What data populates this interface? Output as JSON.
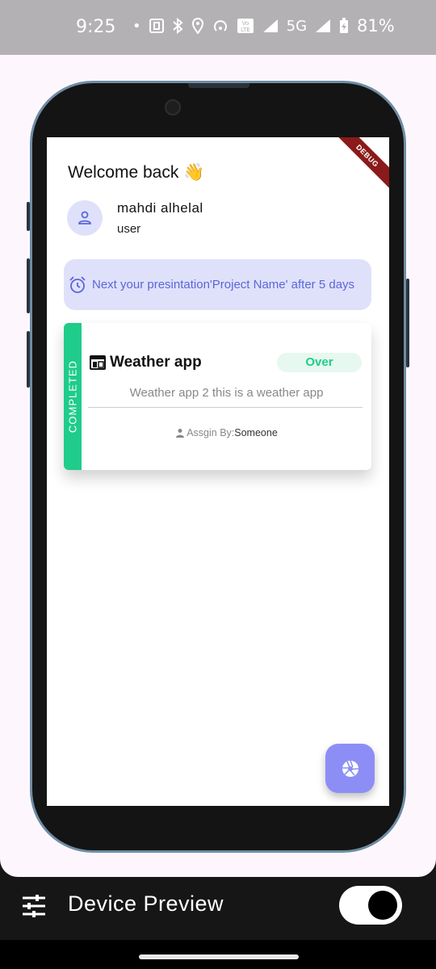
{
  "status_bar": {
    "time": "9:25",
    "network": "5G",
    "battery": "81%"
  },
  "app": {
    "debug_banner": "DEBUG",
    "greeting": "Welcome back 👋",
    "user": {
      "name": "mahdi alhelal",
      "role": "user"
    },
    "reminder": "Next your presintation'Project Name' after 5 days",
    "project_card": {
      "status": "COMPLETED",
      "status_color": "#1fcc8a",
      "title": "Weather app",
      "badge": "Over",
      "description": "Weather app 2 this is a weather app",
      "assign_prefix": "Assgin By:",
      "assign_by": "Someone"
    },
    "fab_icon": "aperture-icon"
  },
  "device_preview": {
    "title": "Device Preview",
    "toggle_on": true
  },
  "colors": {
    "accent": "#8c8ef6",
    "banner_bg": "#dfe1fb",
    "banner_text": "#5b66d6",
    "phone_frame": "#6f8ca4"
  }
}
